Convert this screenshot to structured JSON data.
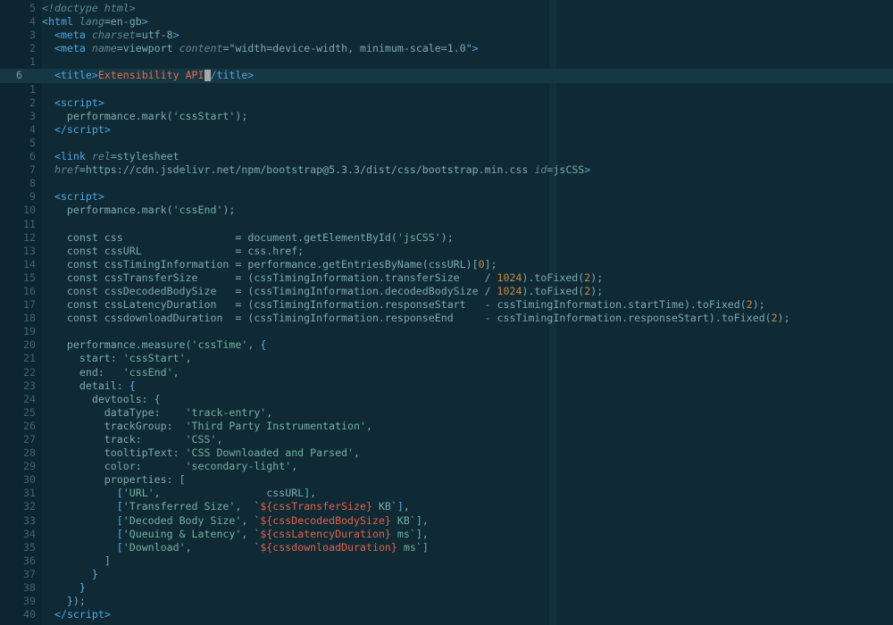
{
  "editor": {
    "language": "html",
    "current_line": 6,
    "lines": [
      {
        "n": "5",
        "tokens": [
          [
            "t-cmt",
            "<!doctype html>"
          ]
        ]
      },
      {
        "n": "4",
        "tokens": [
          [
            "t-tag",
            "<"
          ],
          [
            "t-tagname",
            "html"
          ],
          [
            "t-plain",
            " "
          ],
          [
            "t-attr",
            "lang"
          ],
          [
            "t-plain",
            "=en-gb"
          ],
          [
            "t-tag",
            ">"
          ]
        ]
      },
      {
        "n": "3",
        "tokens": [
          [
            "t-plain",
            "  "
          ],
          [
            "t-tag",
            "<"
          ],
          [
            "t-tagname",
            "meta"
          ],
          [
            "t-plain",
            " "
          ],
          [
            "t-attr",
            "charset"
          ],
          [
            "t-plain",
            "=utf-8"
          ],
          [
            "t-tag",
            ">"
          ]
        ]
      },
      {
        "n": "2",
        "tokens": [
          [
            "t-plain",
            "  "
          ],
          [
            "t-tag",
            "<"
          ],
          [
            "t-tagname",
            "meta"
          ],
          [
            "t-plain",
            " "
          ],
          [
            "t-attr",
            "name"
          ],
          [
            "t-plain",
            "=viewport "
          ],
          [
            "t-attr",
            "content"
          ],
          [
            "t-plain",
            "=\"width=device-width, minimum-scale=1.0\""
          ],
          [
            "t-tag",
            ">"
          ]
        ]
      },
      {
        "n": "1",
        "tokens": []
      },
      {
        "n": "6",
        "current": true,
        "tokens": [
          [
            "t-plain",
            "  "
          ],
          [
            "t-tag",
            "<"
          ],
          [
            "t-tagname",
            "title"
          ],
          [
            "t-tag",
            ">"
          ],
          [
            "t-title",
            "Extensibility API"
          ],
          [
            "cursor",
            ""
          ],
          [
            "t-tag",
            "/"
          ],
          [
            "t-tagname",
            "title"
          ],
          [
            "t-tag",
            ">"
          ]
        ]
      },
      {
        "n": "1",
        "tokens": []
      },
      {
        "n": "2",
        "tokens": [
          [
            "t-plain",
            "  "
          ],
          [
            "t-tag",
            "<"
          ],
          [
            "t-tagname",
            "script"
          ],
          [
            "t-tag",
            ">"
          ]
        ]
      },
      {
        "n": "3",
        "tokens": [
          [
            "t-plain",
            "    performance.mark("
          ],
          [
            "t-str",
            "'cssStart'"
          ],
          [
            "t-plain",
            ");"
          ]
        ]
      },
      {
        "n": "4",
        "tokens": [
          [
            "t-plain",
            "  "
          ],
          [
            "t-tag",
            "</"
          ],
          [
            "t-tagname",
            "script"
          ],
          [
            "t-tag",
            ">"
          ]
        ]
      },
      {
        "n": "5",
        "tokens": []
      },
      {
        "n": "6",
        "tokens": [
          [
            "t-plain",
            "  "
          ],
          [
            "t-tag",
            "<"
          ],
          [
            "t-tagname",
            "link"
          ],
          [
            "t-plain",
            " "
          ],
          [
            "t-attr",
            "rel"
          ],
          [
            "t-plain",
            "=stylesheet"
          ]
        ]
      },
      {
        "n": "7",
        "tokens": [
          [
            "t-plain",
            "  "
          ],
          [
            "t-attr",
            "href"
          ],
          [
            "t-plain",
            "=https://cdn.jsdelivr.net/npm/bootstrap@5.3.3/dist/css/bootstrap.min.css "
          ],
          [
            "t-attr",
            "id"
          ],
          [
            "t-plain",
            "=jsCSS"
          ],
          [
            "t-tag",
            ">"
          ]
        ]
      },
      {
        "n": "8",
        "tokens": []
      },
      {
        "n": "9",
        "tokens": [
          [
            "t-plain",
            "  "
          ],
          [
            "t-tag",
            "<"
          ],
          [
            "t-tagname",
            "script"
          ],
          [
            "t-tag",
            ">"
          ]
        ]
      },
      {
        "n": "10",
        "tokens": [
          [
            "t-plain",
            "    performance.mark("
          ],
          [
            "t-str",
            "'cssEnd'"
          ],
          [
            "t-plain",
            ");"
          ]
        ]
      },
      {
        "n": "11",
        "tokens": []
      },
      {
        "n": "12",
        "tokens": [
          [
            "t-plain",
            "    const css                  = document.getElementById("
          ],
          [
            "t-str",
            "'jsCSS'"
          ],
          [
            "t-plain",
            ");"
          ]
        ]
      },
      {
        "n": "13",
        "tokens": [
          [
            "t-plain",
            "    const cssURL               = css.href;"
          ]
        ]
      },
      {
        "n": "14",
        "tokens": [
          [
            "t-plain",
            "    const cssTimingInformation = performance.getEntriesByName(cssURL)["
          ],
          [
            "t-num",
            "0"
          ],
          [
            "t-plain",
            "];"
          ]
        ]
      },
      {
        "n": "15",
        "tokens": [
          [
            "t-plain",
            "    const cssTransferSize      = (cssTimingInformation.transferSize    / "
          ],
          [
            "t-num",
            "1024"
          ],
          [
            "t-plain",
            ").toFixed("
          ],
          [
            "t-num",
            "2"
          ],
          [
            "t-plain",
            ");"
          ]
        ]
      },
      {
        "n": "16",
        "tokens": [
          [
            "t-plain",
            "    const cssDecodedBodySize   = (cssTimingInformation.decodedBodySize / "
          ],
          [
            "t-num",
            "1024"
          ],
          [
            "t-plain",
            ").toFixed("
          ],
          [
            "t-num",
            "2"
          ],
          [
            "t-plain",
            ");"
          ]
        ]
      },
      {
        "n": "17",
        "tokens": [
          [
            "t-plain",
            "    const cssLatencyDuration   = (cssTimingInformation.responseStart   - cssTimingInformation.startTime).toFixed("
          ],
          [
            "t-num",
            "2"
          ],
          [
            "t-plain",
            ");"
          ]
        ]
      },
      {
        "n": "18",
        "tokens": [
          [
            "t-plain",
            "    const cssdownloadDuration  = (cssTimingInformation.responseEnd     - cssTimingInformation.responseStart).toFixed("
          ],
          [
            "t-num",
            "2"
          ],
          [
            "t-plain",
            ");"
          ]
        ]
      },
      {
        "n": "19",
        "tokens": []
      },
      {
        "n": "20",
        "tokens": [
          [
            "t-plain",
            "    performance.measure("
          ],
          [
            "t-str",
            "'cssTime'"
          ],
          [
            "t-plain",
            ", "
          ],
          [
            "t-punct",
            "{"
          ]
        ]
      },
      {
        "n": "21",
        "tokens": [
          [
            "t-plain",
            "      start: "
          ],
          [
            "t-str",
            "'cssStart'"
          ],
          [
            "t-plain",
            ","
          ]
        ]
      },
      {
        "n": "22",
        "tokens": [
          [
            "t-plain",
            "      end:   "
          ],
          [
            "t-str",
            "'cssEnd'"
          ],
          [
            "t-plain",
            ","
          ]
        ]
      },
      {
        "n": "23",
        "tokens": [
          [
            "t-plain",
            "      detail: "
          ],
          [
            "t-punct",
            "{"
          ]
        ]
      },
      {
        "n": "24",
        "tokens": [
          [
            "t-plain",
            "        devtools: "
          ],
          [
            "t-punct",
            "{"
          ]
        ]
      },
      {
        "n": "25",
        "tokens": [
          [
            "t-plain",
            "          dataType:    "
          ],
          [
            "t-str",
            "'track-entry'"
          ],
          [
            "t-plain",
            ","
          ]
        ]
      },
      {
        "n": "26",
        "tokens": [
          [
            "t-plain",
            "          trackGroup:  "
          ],
          [
            "t-str",
            "'Third Party Instrumentation'"
          ],
          [
            "t-plain",
            ","
          ]
        ]
      },
      {
        "n": "27",
        "tokens": [
          [
            "t-plain",
            "          track:       "
          ],
          [
            "t-str",
            "'CSS'"
          ],
          [
            "t-plain",
            ","
          ]
        ]
      },
      {
        "n": "28",
        "tokens": [
          [
            "t-plain",
            "          tooltipText: "
          ],
          [
            "t-str",
            "'CSS Downloaded and Parsed'"
          ],
          [
            "t-plain",
            ","
          ]
        ]
      },
      {
        "n": "29",
        "tokens": [
          [
            "t-plain",
            "          color:       "
          ],
          [
            "t-str",
            "'secondary-light'"
          ],
          [
            "t-plain",
            ","
          ]
        ]
      },
      {
        "n": "30",
        "tokens": [
          [
            "t-plain",
            "          properties: "
          ],
          [
            "t-punct",
            "["
          ]
        ]
      },
      {
        "n": "31",
        "tokens": [
          [
            "t-plain",
            "            "
          ],
          [
            "t-punct",
            "["
          ],
          [
            "t-str",
            "'URL'"
          ],
          [
            "t-plain",
            ",                 cssURL"
          ],
          [
            "t-punct",
            "]"
          ],
          [
            "t-plain",
            ","
          ]
        ]
      },
      {
        "n": "32",
        "tokens": [
          [
            "t-plain",
            "            "
          ],
          [
            "t-punct",
            "["
          ],
          [
            "t-str",
            "'Transferred Size'"
          ],
          [
            "t-plain",
            ",  "
          ],
          [
            "t-str",
            "`"
          ],
          [
            "t-red",
            "${cssTransferSize}"
          ],
          [
            "t-str",
            " KB`"
          ],
          [
            "t-punct",
            "]"
          ],
          [
            "t-plain",
            ","
          ]
        ]
      },
      {
        "n": "33",
        "tokens": [
          [
            "t-plain",
            "            "
          ],
          [
            "t-punct",
            "["
          ],
          [
            "t-str",
            "'Decoded Body Size'"
          ],
          [
            "t-plain",
            ", "
          ],
          [
            "t-str",
            "`"
          ],
          [
            "t-red",
            "${cssDecodedBodySize}"
          ],
          [
            "t-str",
            " KB`"
          ],
          [
            "t-punct",
            "]"
          ],
          [
            "t-plain",
            ","
          ]
        ]
      },
      {
        "n": "34",
        "tokens": [
          [
            "t-plain",
            "            "
          ],
          [
            "t-punct",
            "["
          ],
          [
            "t-str",
            "'Queuing & Latency'"
          ],
          [
            "t-plain",
            ", "
          ],
          [
            "t-str",
            "`"
          ],
          [
            "t-red",
            "${cssLatencyDuration}"
          ],
          [
            "t-str",
            " ms`"
          ],
          [
            "t-punct",
            "]"
          ],
          [
            "t-plain",
            ","
          ]
        ]
      },
      {
        "n": "35",
        "tokens": [
          [
            "t-plain",
            "            "
          ],
          [
            "t-punct",
            "["
          ],
          [
            "t-str",
            "'Download'"
          ],
          [
            "t-plain",
            ",          "
          ],
          [
            "t-str",
            "`"
          ],
          [
            "t-red",
            "${cssdownloadDuration}"
          ],
          [
            "t-str",
            " ms`"
          ],
          [
            "t-punct",
            "]"
          ]
        ]
      },
      {
        "n": "36",
        "tokens": [
          [
            "t-plain",
            "          "
          ],
          [
            "t-punct",
            "]"
          ]
        ]
      },
      {
        "n": "37",
        "tokens": [
          [
            "t-plain",
            "        "
          ],
          [
            "t-punct",
            "}"
          ]
        ]
      },
      {
        "n": "38",
        "tokens": [
          [
            "t-plain",
            "      "
          ],
          [
            "t-punct",
            "}"
          ]
        ]
      },
      {
        "n": "39",
        "tokens": [
          [
            "t-plain",
            "    "
          ],
          [
            "t-punct",
            "}"
          ],
          [
            "t-plain",
            ");"
          ]
        ]
      },
      {
        "n": "40",
        "tokens": [
          [
            "t-plain",
            "  "
          ],
          [
            "t-tag",
            "</"
          ],
          [
            "t-tagname",
            "script"
          ],
          [
            "t-tag",
            ">"
          ]
        ]
      }
    ]
  }
}
